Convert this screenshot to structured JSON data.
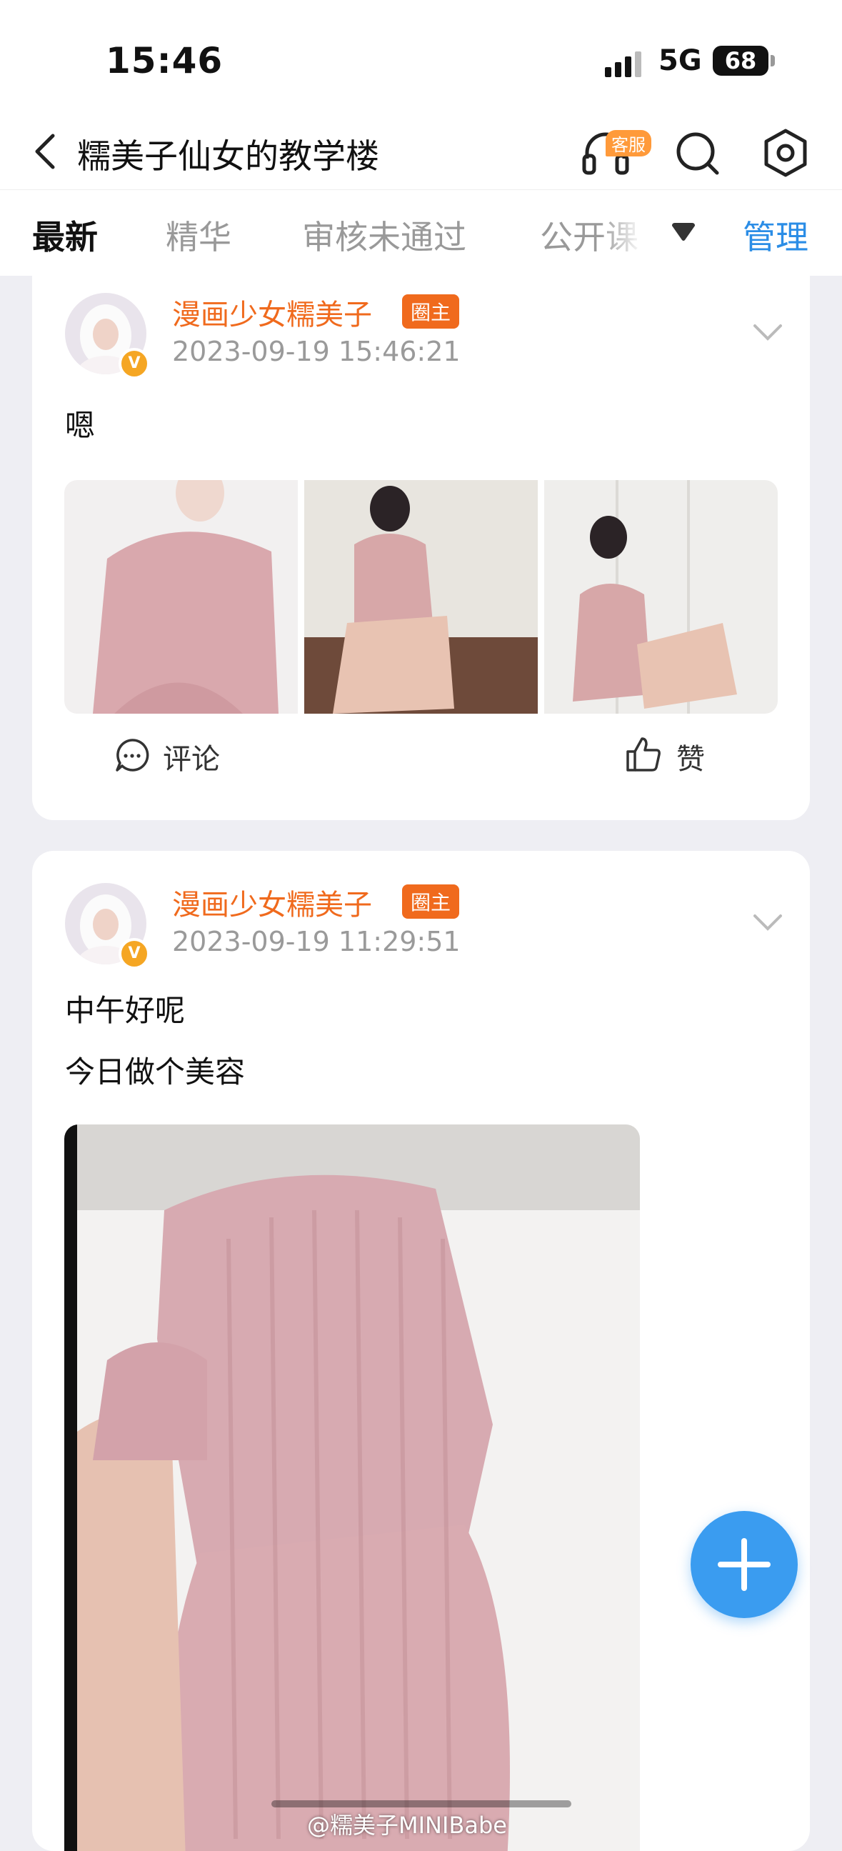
{
  "status_bar": {
    "time": "15:46",
    "network": "5G",
    "battery": "68"
  },
  "header": {
    "title": "糯美子仙女的教学楼",
    "service_badge": "客服"
  },
  "tabs": [
    "最新",
    "精华",
    "审核未通过",
    "公开课"
  ],
  "tabs_manage": "管理",
  "posts": [
    {
      "author": "漫画少女糯美子",
      "role": "圈主",
      "timestamp": "2023-09-19 15:46:21",
      "text_lines": [
        "嗯"
      ],
      "actions": {
        "comment": "评论",
        "like": "赞"
      }
    },
    {
      "author": "漫画少女糯美子",
      "role": "圈主",
      "timestamp": "2023-09-19 11:29:51",
      "text_lines": [
        "中午好呢",
        "今日做个美容"
      ]
    }
  ],
  "watermark": "@糯美子MINIBabe",
  "colors": {
    "accent_orange": "#f06a1d",
    "link_blue": "#2b8de6",
    "fab_blue": "#3a9cf0"
  },
  "icons": {
    "back": "chevron-left-icon",
    "service": "headset-icon",
    "search": "search-icon",
    "settings": "hexagon-settings-icon",
    "more": "triangle-down-icon",
    "comment": "speech-bubble-icon",
    "like": "thumbs-up-icon",
    "compose": "plus-icon"
  }
}
